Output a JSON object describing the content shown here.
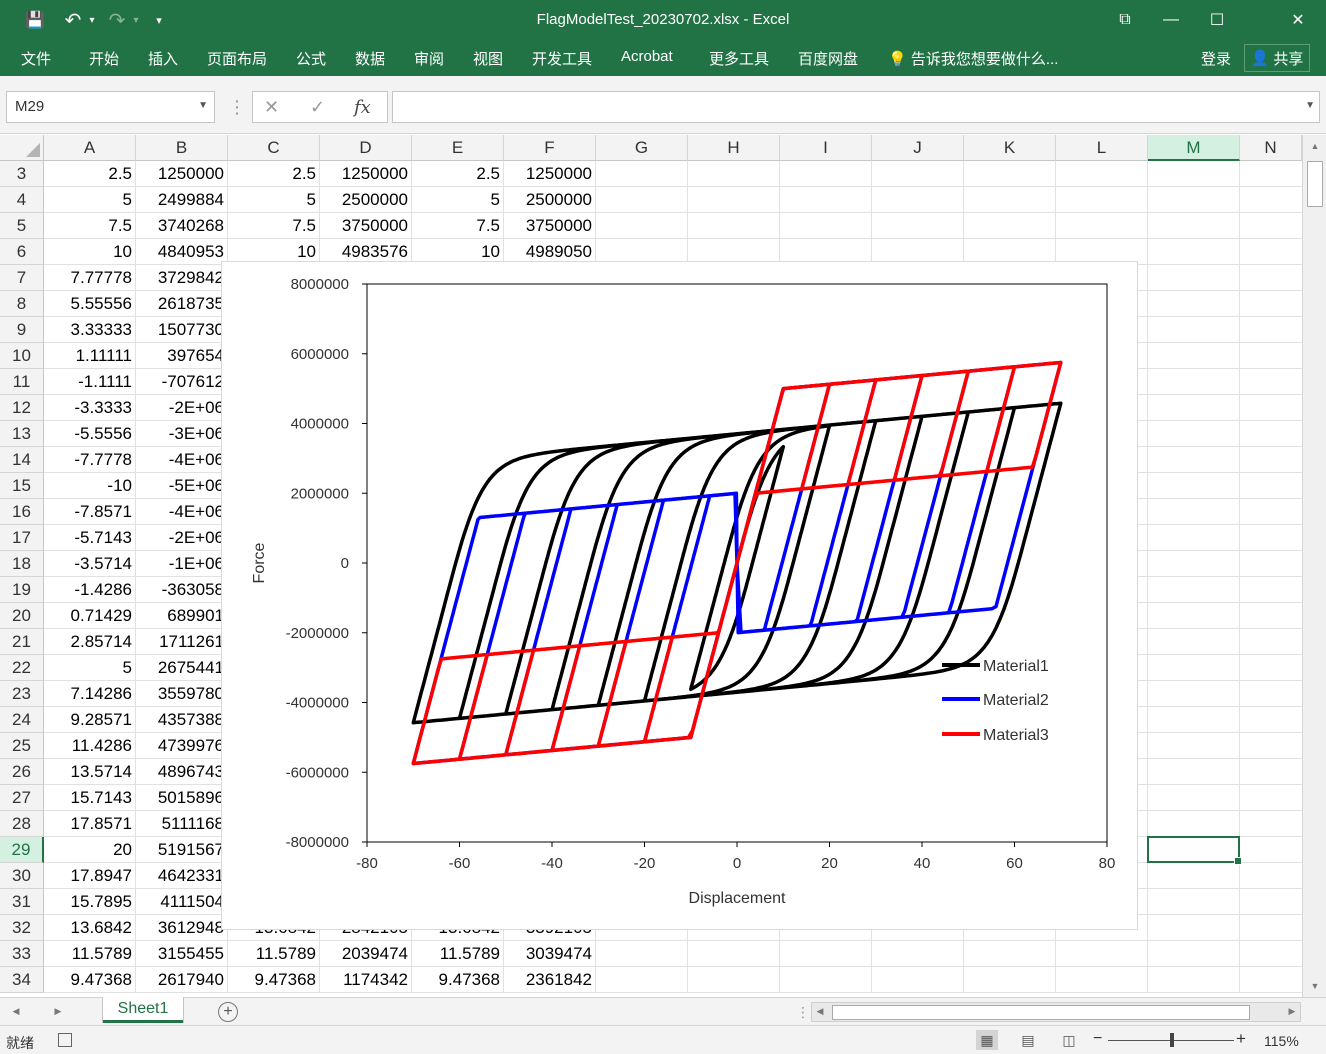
{
  "window": {
    "title": "FlagModelTest_20230702.xlsx - Excel",
    "quick_access": {
      "save": "💾",
      "undo": "↶",
      "redo": "↷",
      "customize": "▾"
    },
    "controls": {
      "ribbon_display": "⧉",
      "minimize": "—",
      "maximize": "☐",
      "close": "✕"
    }
  },
  "ribbon": {
    "tabs": [
      "文件",
      "开始",
      "插入",
      "页面布局",
      "公式",
      "数据",
      "审阅",
      "视图",
      "开发工具",
      "Acrobat",
      "更多工具",
      "百度网盘"
    ],
    "tell_me": "告诉我您想要做什么...",
    "login": "登录",
    "share": "共享"
  },
  "formula_bar": {
    "name_box": "M29",
    "cancel": "✕",
    "enter": "✓",
    "fx": "fx",
    "formula": ""
  },
  "grid": {
    "columns": [
      "A",
      "B",
      "C",
      "D",
      "E",
      "F",
      "G",
      "H",
      "I",
      "J",
      "K",
      "L",
      "M",
      "N"
    ],
    "selected_column": "M",
    "selected_row": "29",
    "rows": [
      {
        "n": "3",
        "cells": [
          "2.5",
          "1250000",
          "2.5",
          "1250000",
          "2.5",
          "1250000"
        ]
      },
      {
        "n": "4",
        "cells": [
          "5",
          "2499884",
          "5",
          "2500000",
          "5",
          "2500000"
        ]
      },
      {
        "n": "5",
        "cells": [
          "7.5",
          "3740268",
          "7.5",
          "3750000",
          "7.5",
          "3750000"
        ]
      },
      {
        "n": "6",
        "cells": [
          "10",
          "4840953",
          "10",
          "4983576",
          "10",
          "4989050"
        ]
      },
      {
        "n": "7",
        "cells": [
          "7.77778",
          "3729842",
          "",
          "",
          "",
          ""
        ]
      },
      {
        "n": "8",
        "cells": [
          "5.55556",
          "2618735",
          "",
          "",
          "",
          ""
        ]
      },
      {
        "n": "9",
        "cells": [
          "3.33333",
          "1507730",
          "",
          "",
          "",
          ""
        ]
      },
      {
        "n": "10",
        "cells": [
          "1.11111",
          "397654",
          "",
          "",
          "",
          ""
        ]
      },
      {
        "n": "11",
        "cells": [
          "-1.1111",
          "-707612",
          "",
          "",
          "",
          ""
        ]
      },
      {
        "n": "12",
        "cells": [
          "-3.3333",
          "-2E+06",
          "",
          "",
          "",
          ""
        ]
      },
      {
        "n": "13",
        "cells": [
          "-5.5556",
          "-3E+06",
          "",
          "",
          "",
          ""
        ]
      },
      {
        "n": "14",
        "cells": [
          "-7.7778",
          "-4E+06",
          "",
          "",
          "",
          ""
        ]
      },
      {
        "n": "15",
        "cells": [
          "-10",
          "-5E+06",
          "",
          "",
          "",
          ""
        ]
      },
      {
        "n": "16",
        "cells": [
          "-7.8571",
          "-4E+06",
          "",
          "",
          "",
          ""
        ]
      },
      {
        "n": "17",
        "cells": [
          "-5.7143",
          "-2E+06",
          "",
          "",
          "",
          ""
        ]
      },
      {
        "n": "18",
        "cells": [
          "-3.5714",
          "-1E+06",
          "",
          "",
          "",
          ""
        ]
      },
      {
        "n": "19",
        "cells": [
          "-1.4286",
          "-363058",
          "",
          "",
          "",
          ""
        ]
      },
      {
        "n": "20",
        "cells": [
          "0.71429",
          "689901",
          "",
          "",
          "",
          ""
        ]
      },
      {
        "n": "21",
        "cells": [
          "2.85714",
          "1711261",
          "",
          "",
          "",
          ""
        ]
      },
      {
        "n": "22",
        "cells": [
          "5",
          "2675441",
          "",
          "",
          "",
          ""
        ]
      },
      {
        "n": "23",
        "cells": [
          "7.14286",
          "3559780",
          "",
          "",
          "",
          ""
        ]
      },
      {
        "n": "24",
        "cells": [
          "9.28571",
          "4357388",
          "",
          "",
          "",
          ""
        ]
      },
      {
        "n": "25",
        "cells": [
          "11.4286",
          "4739976",
          "",
          "",
          "",
          ""
        ]
      },
      {
        "n": "26",
        "cells": [
          "13.5714",
          "4896743",
          "",
          "",
          "",
          ""
        ]
      },
      {
        "n": "27",
        "cells": [
          "15.7143",
          "5015896",
          "",
          "",
          "",
          ""
        ]
      },
      {
        "n": "28",
        "cells": [
          "17.8571",
          "5111168",
          "",
          "",
          "",
          ""
        ]
      },
      {
        "n": "29",
        "cells": [
          "20",
          "5191567",
          "",
          "",
          "",
          ""
        ]
      },
      {
        "n": "30",
        "cells": [
          "17.8947",
          "4642331",
          "",
          "",
          "",
          ""
        ]
      },
      {
        "n": "31",
        "cells": [
          "15.7895",
          "4111504",
          "",
          "",
          "",
          ""
        ]
      },
      {
        "n": "32",
        "cells": [
          "13.6842",
          "3612948",
          "13.6842",
          "2842105",
          "13.6842",
          "3392105"
        ]
      },
      {
        "n": "33",
        "cells": [
          "11.5789",
          "3155455",
          "11.5789",
          "2039474",
          "11.5789",
          "3039474"
        ]
      },
      {
        "n": "34",
        "cells": [
          "9.47368",
          "2617940",
          "9.47368",
          "1174342",
          "9.47368",
          "2361842"
        ]
      }
    ]
  },
  "chart_data": {
    "type": "scatter",
    "title": "",
    "xlabel": "Displacement",
    "ylabel": "Force",
    "xlim": [
      -80,
      80
    ],
    "ylim": [
      -8000000,
      8000000
    ],
    "xticks": [
      "-80",
      "-60",
      "-40",
      "-20",
      "0",
      "20",
      "40",
      "60",
      "80"
    ],
    "yticks": [
      "8000000",
      "6000000",
      "4000000",
      "2000000",
      "0",
      "-2000000",
      "-4000000",
      "-6000000",
      "-8000000"
    ],
    "legend_position": "bottom-right",
    "grid": false,
    "amplitudes": [
      10,
      20,
      30,
      40,
      50,
      60,
      70
    ],
    "series": [
      {
        "name": "Material1",
        "color": "#000000",
        "model": "smooth-hysteresis",
        "k": 500000,
        "fy": 3800000,
        "b": 0.025
      },
      {
        "name": "Material2",
        "color": "#0000ff",
        "model": "flag",
        "k": 500000,
        "fy": 5000000,
        "b": 0.025,
        "beta": 1.4
      },
      {
        "name": "Material3",
        "color": "#ff0000",
        "model": "flag",
        "k": 500000,
        "fy": 5000000,
        "b": 0.025,
        "beta": 0.6
      }
    ]
  },
  "sheets": {
    "active": "Sheet1",
    "add": "+"
  },
  "status": {
    "ready": "就绪",
    "zoom": "115%",
    "zoom_minus": "−",
    "zoom_plus": "+"
  }
}
